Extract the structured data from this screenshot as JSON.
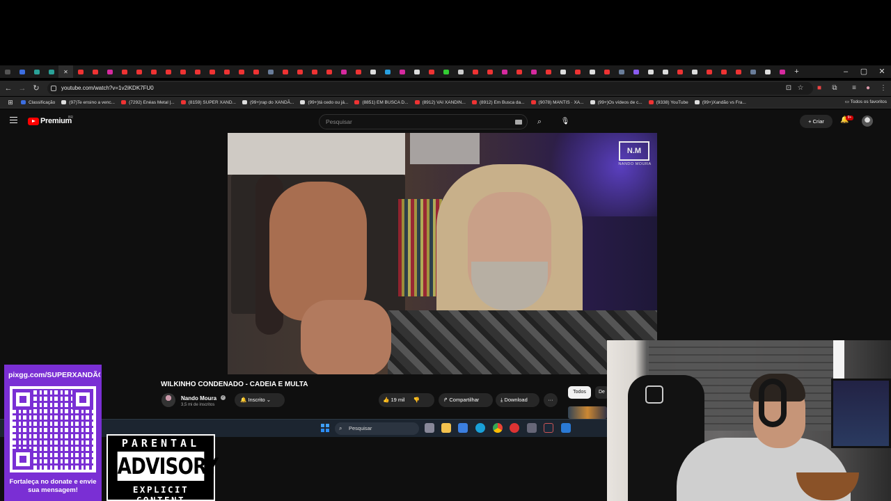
{
  "browser": {
    "url": "youtube.com/watch?v=1v2iKDK7FU0",
    "bookmarks": [
      "Classificação",
      "(97)Te ensino a venc...",
      "(7292) Enéas Metal |...",
      "(8159) SUPER XAND...",
      "(99+)rap do XANDÃ...",
      "(99+)tá cedo ou já...",
      "(8851) EM BUSCA D...",
      "(8912) VAI XANDIN...",
      "(8912) Em Busca da...",
      "(9078) MANTIS · XA...",
      "(99+)Os vídeos de c...",
      "(9338) YouTube",
      "(99+)Xandão vs Fra..."
    ],
    "all_favorites": "Todos os favoritos",
    "window_controls": [
      "–",
      "▢",
      "✕"
    ],
    "new_tab": "+",
    "tab_close": "✕"
  },
  "youtube": {
    "logo_text": "Premium",
    "region": "BR",
    "search_placeholder": "Pesquisar",
    "create_label": "Criar",
    "notification_count": "9+",
    "video": {
      "watermark": "N.M",
      "watermark_sub": "NANDO MOURA"
    },
    "title": "WILKINHO CONDENADO - CADEIA E MULTA",
    "channel_name": "Nando Moura",
    "subscribers": "3,5 mi de inscritos",
    "subscribed_label": "Inscrito",
    "likes": "19 mil",
    "share_label": "Compartilhar",
    "download_label": "Download",
    "more_label": "···",
    "chips": [
      "Todos",
      "De"
    ]
  },
  "taskbar": {
    "search_placeholder": "Pesquisar"
  },
  "overlay": {
    "donate_url": "pixgg.com/SUPERXANDÃO",
    "donate_message": "Fortaleça no donate e envie sua mensagem!",
    "advisory_top": "PARENTAL",
    "advisory_mid": "ADVISORY",
    "advisory_bot": "EXPLICIT CONTENT"
  },
  "colors": {
    "youtube_red": "#ff0000",
    "donate_purple": "#7a2fd4",
    "page_bg": "#0f0f0f"
  }
}
